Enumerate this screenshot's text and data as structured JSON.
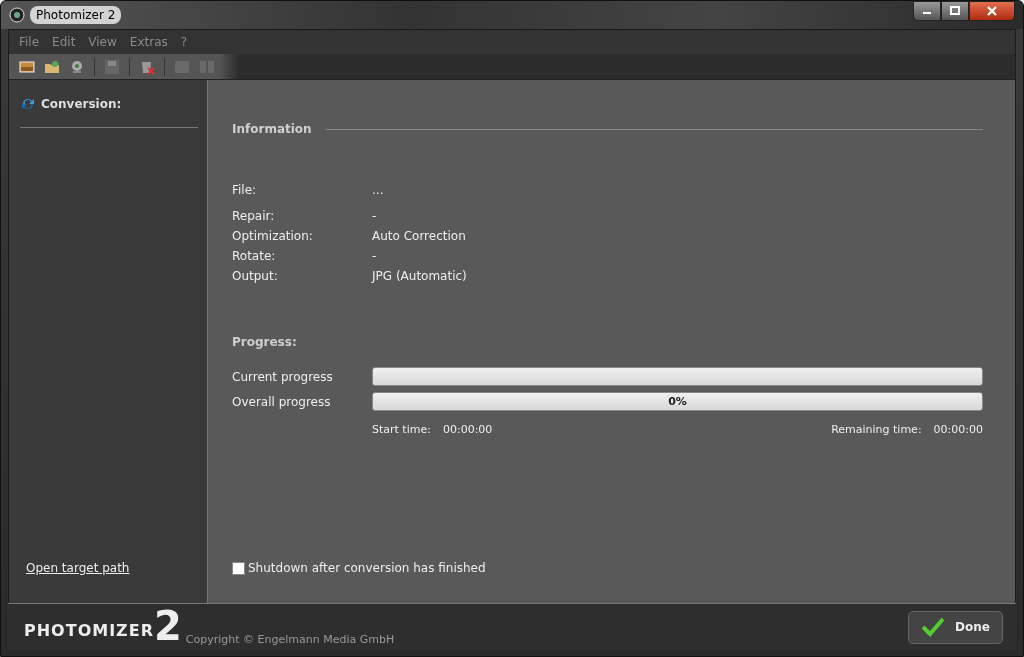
{
  "window": {
    "title": "Photomizer 2"
  },
  "menu": [
    "File",
    "Edit",
    "View",
    "Extras",
    "?"
  ],
  "sidebar": {
    "heading": "Conversion:",
    "link": "Open target path"
  },
  "information": {
    "heading": "Information",
    "rows": [
      {
        "label": "File:",
        "value": "..."
      },
      {
        "label": "Repair:",
        "value": "-"
      },
      {
        "label": "Optimization:",
        "value": "Auto Correction"
      },
      {
        "label": "Rotate:",
        "value": "-"
      },
      {
        "label": "Output:",
        "value": "JPG (Automatic)"
      }
    ]
  },
  "progress": {
    "heading": "Progress:",
    "bars": [
      {
        "label": "Current progress",
        "level": 0
      },
      {
        "label": "Overall progress",
        "level": 0,
        "reading": "0%"
      }
    ],
    "start_label": "Start time:",
    "start_time": "00:00:00",
    "remaining_label": "Remaining time:",
    "remaining_time": "00:00:00"
  },
  "shutdown": {
    "label": "Shutdown after conversion has finished",
    "checked": false
  },
  "footer": {
    "logo_text": "PHOTOMIZER",
    "logo_number": "2",
    "copyright": "Copyright © Engelmann Media GmbH",
    "done": "Done"
  }
}
